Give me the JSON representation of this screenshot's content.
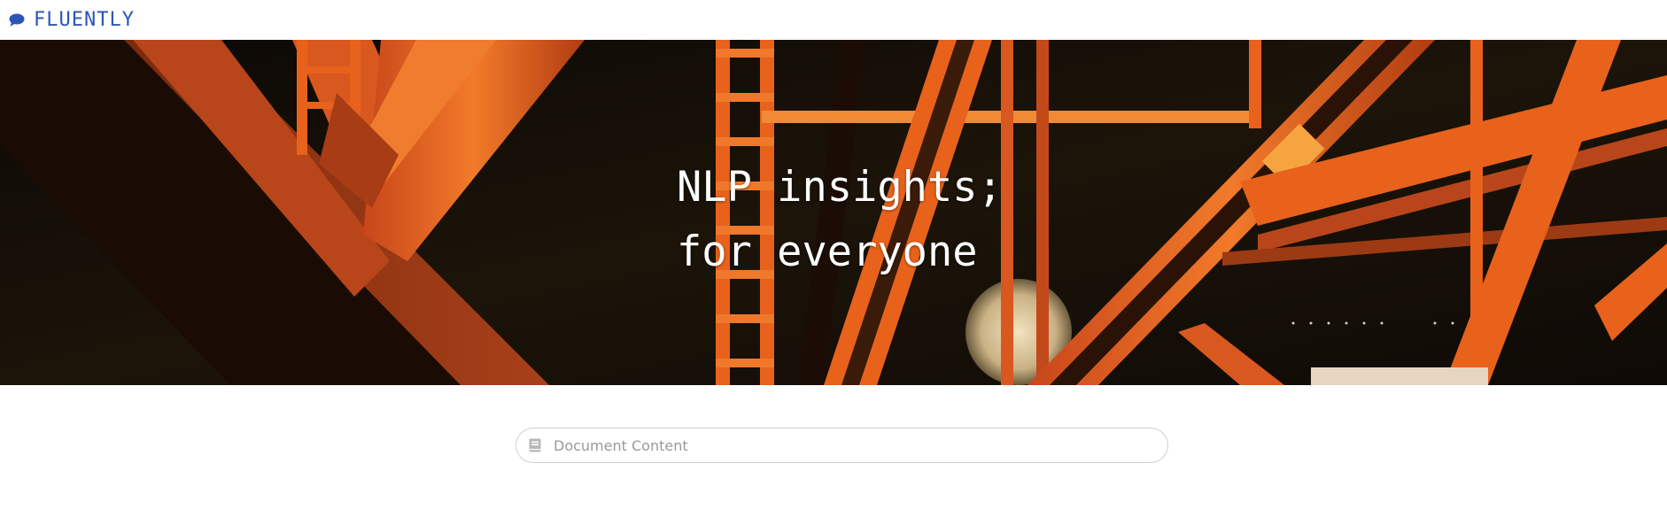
{
  "navbar": {
    "brand_text": "FLUENTLY",
    "brand_icon": "comment-icon",
    "brand_color": "#2b55b8"
  },
  "hero": {
    "line1": "NLP insights;",
    "line2": "for everyone",
    "image": "orange-steel-bridge-night"
  },
  "search": {
    "placeholder": "Document Content",
    "value": "",
    "icon": "book-icon"
  },
  "colors": {
    "accent": "#2b55b8",
    "steel_orange": "#e8621c",
    "hero_bg": "#120d07"
  }
}
